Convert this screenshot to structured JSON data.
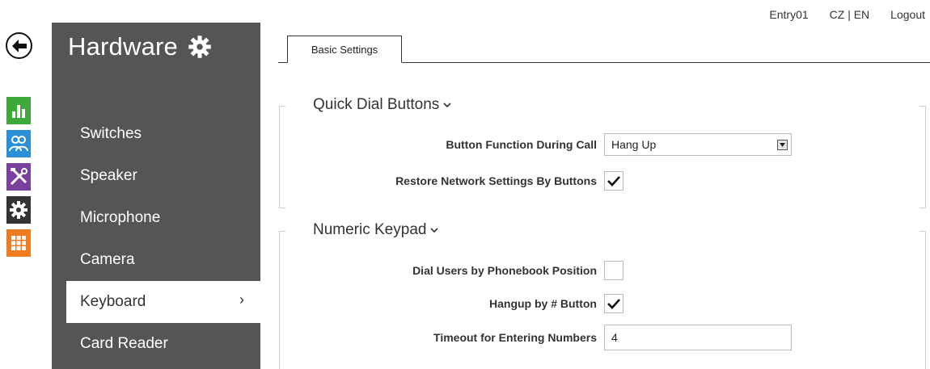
{
  "top_links": {
    "device": "Entry01",
    "language": "CZ | EN",
    "logout": "Logout"
  },
  "colors": {
    "sidebar_bg": "#555555",
    "icon_status": "#3ea83a",
    "icon_users": "#2b8fd6",
    "icon_services": "#7b3f9e",
    "icon_hardware": "#333333",
    "icon_system": "#f07c22"
  },
  "icons": [
    "back-arrow-icon",
    "status-chart-icon",
    "users-icon",
    "services-tools-icon",
    "hardware-gear-icon",
    "system-grid-icon"
  ],
  "sidebar": {
    "title": "Hardware",
    "items": [
      {
        "label": "Switches"
      },
      {
        "label": "Speaker"
      },
      {
        "label": "Microphone"
      },
      {
        "label": "Camera"
      },
      {
        "label": "Keyboard",
        "chevron": "›"
      },
      {
        "label": "Card Reader"
      }
    ]
  },
  "tabs": [
    {
      "label": "Basic Settings"
    }
  ],
  "quick_dial": {
    "title": "Quick Dial Buttons",
    "button_function_label": "Button Function During Call",
    "button_function_value": "Hang Up",
    "restore_label": "Restore Network Settings By Buttons",
    "restore_checked": true
  },
  "numeric_keypad": {
    "title": "Numeric Keypad",
    "dial_users_label": "Dial Users by Phonebook Position",
    "dial_users_checked": false,
    "hangup_label": "Hangup by # Button",
    "hangup_checked": true,
    "timeout_label": "Timeout for Entering Numbers",
    "timeout_value": "4"
  }
}
